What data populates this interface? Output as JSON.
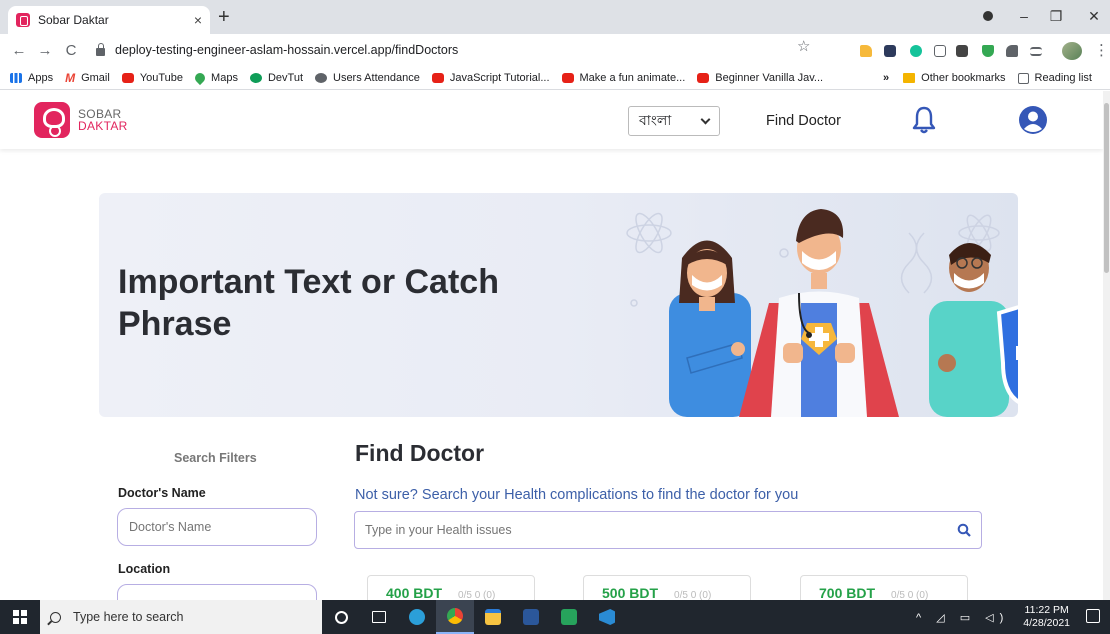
{
  "browser": {
    "tab_title": "Sobar Daktar",
    "tab_close": "×",
    "new_tab": "+",
    "url": "deploy-testing-engineer-aslam-hossain.vercel.app/findDoctors",
    "star": "☆",
    "back": "←",
    "forward": "→",
    "reload": "C",
    "menu": "⋮",
    "win_min": "–",
    "win_max": "❐",
    "win_close": "✕"
  },
  "bookmarks": {
    "items": [
      {
        "label": "Apps",
        "icon": "apps-grid-icon"
      },
      {
        "label": "Gmail",
        "icon": "gmail-icon"
      },
      {
        "label": "YouTube",
        "icon": "youtube-icon"
      },
      {
        "label": "Maps",
        "icon": "maps-pin-icon"
      },
      {
        "label": "DevTut",
        "icon": "devtut-icon"
      },
      {
        "label": "Users Attendance",
        "icon": "globe-icon"
      },
      {
        "label": "JavaScript Tutorial...",
        "icon": "youtube-icon"
      },
      {
        "label": "Make a fun animate...",
        "icon": "youtube-icon"
      },
      {
        "label": "Beginner Vanilla Jav...",
        "icon": "youtube-icon"
      }
    ],
    "overflow": "»",
    "other": "Other bookmarks",
    "reading": "Reading list"
  },
  "header": {
    "logo_line1": "SOBAR",
    "logo_line2": "DAKTAR",
    "language": "বাংলা",
    "find_doctor_link": "Find Doctor"
  },
  "hero": {
    "headline": "Important Text or Catch Phrase"
  },
  "filters": {
    "title": "Search Filters",
    "doctor_name_label": "Doctor's Name",
    "doctor_name_placeholder": "Doctor's Name",
    "location_label": "Location"
  },
  "main": {
    "title": "Find Doctor",
    "subtitle": "Not sure? Search your Health complications to find the doctor for you",
    "search_placeholder": "Type in your Health issues"
  },
  "cards": [
    {
      "price": "400 BDT",
      "rating": "0/5 0 (0)"
    },
    {
      "price": "500 BDT",
      "rating": "0/5 0 (0)"
    },
    {
      "price": "700 BDT",
      "rating": "0/5 0 (0)"
    }
  ],
  "taskbar": {
    "search_placeholder": "Type here to search",
    "tray_icons": "^ ◿ ▭ ◁)",
    "time": "11:22 PM",
    "date": "4/28/2021"
  },
  "colors": {
    "brand": "#e2255e",
    "price_green": "#24a148",
    "link_blue": "#3c5fa8"
  }
}
